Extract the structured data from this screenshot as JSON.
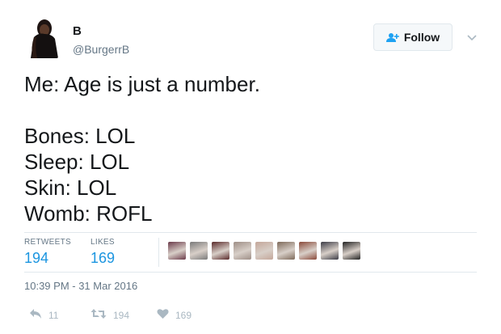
{
  "header": {
    "display_name": "B",
    "handle": "@BurgerrB",
    "follow_label": "Follow"
  },
  "tweet": {
    "lines": [
      "Me: Age is just a number.",
      "",
      "Bones: LOL",
      "Sleep: LOL",
      "Skin: LOL",
      "Womb: ROFL"
    ]
  },
  "stats": {
    "retweets_label": "RETWEETS",
    "retweets_value": "194",
    "likes_label": "LIKES",
    "likes_value": "169",
    "liker_avatar_colors": [
      "#6b3b4a",
      "#7a7a7a",
      "#5a2a2a",
      "#9e8e86",
      "#c4a79a",
      "#7e6a5a",
      "#8a4a3a",
      "#3c3c46",
      "#222222"
    ]
  },
  "timestamp": "10:39 PM - 31 Mar 2016",
  "actions": {
    "reply_count": "11",
    "retweet_count": "194",
    "like_count": "169"
  },
  "colors": {
    "link": "#1b95e0",
    "muted": "#657786",
    "action": "#aab8c2",
    "border": "#e1e8ed"
  },
  "icons": [
    "user-avatar",
    "follow-person-plus-icon",
    "chevron-down-icon",
    "reply-icon",
    "retweet-icon",
    "heart-icon"
  ]
}
